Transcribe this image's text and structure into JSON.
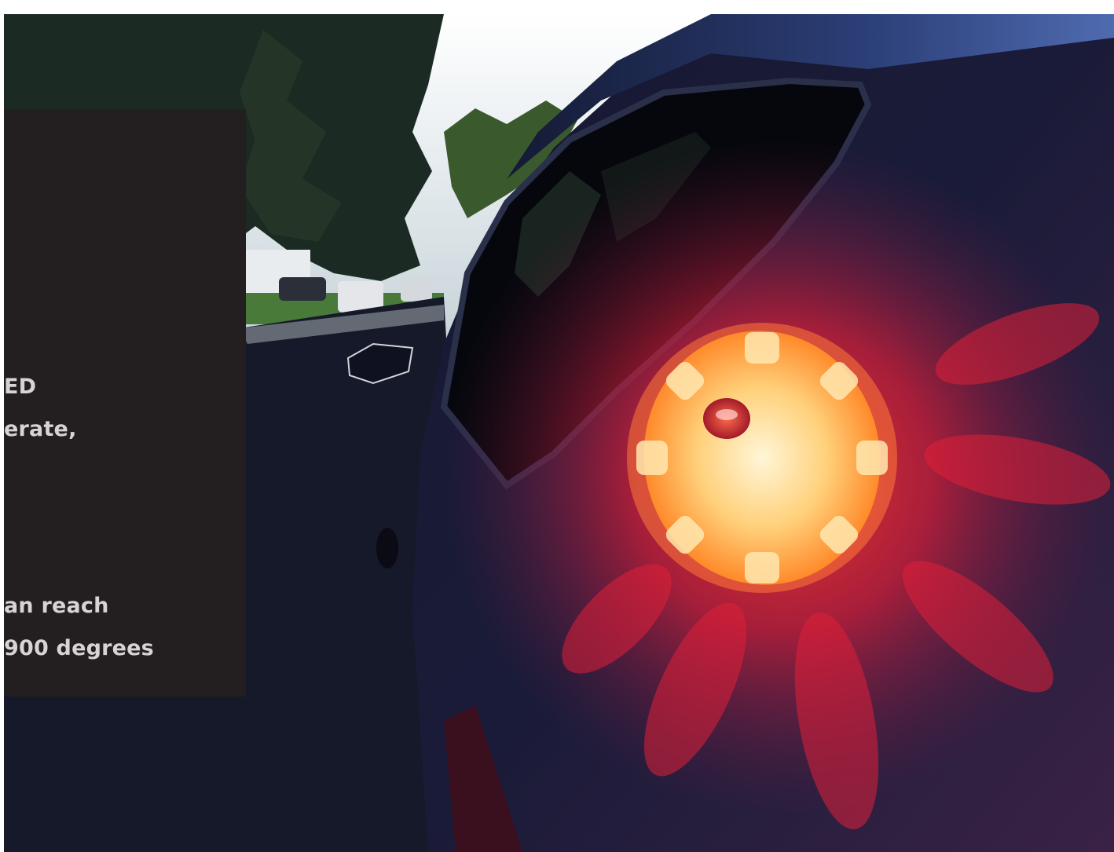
{
  "hero": {
    "photo_alt": "Car with a glowing red LED road flare mounted on its side at dusk",
    "text_lines": [
      "ED",
      "erate,",
      "an reach",
      "900 degrees"
    ]
  },
  "colors": {
    "panel_background": "#231f20",
    "panel_text": "#d8d3d5",
    "flare_glow": "#ff2a1e",
    "flare_core": "#ffd27a"
  }
}
